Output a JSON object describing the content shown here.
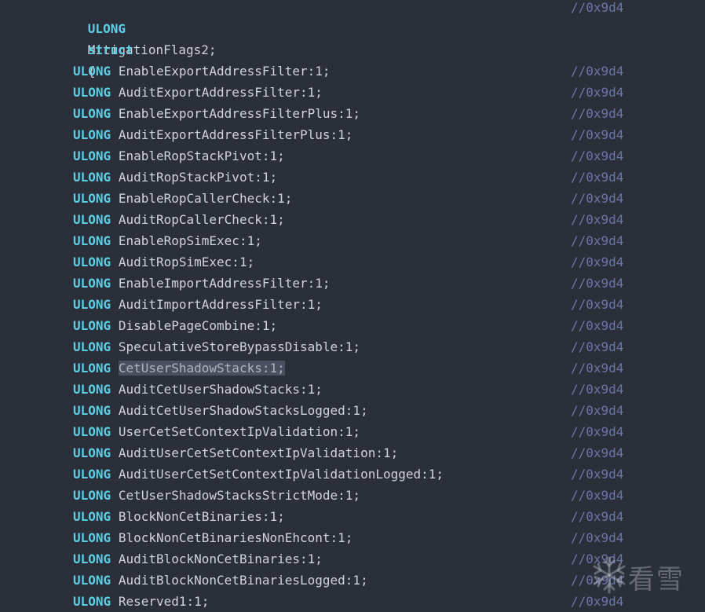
{
  "header": {
    "type_keyword": "ULONG",
    "member": "MitigationFlags2;",
    "comment": "//0x9d4"
  },
  "struct_keyword": "struct",
  "open_brace": "{",
  "fields": [
    {
      "type": "ULONG",
      "decl": "EnableExportAddressFilter:1;",
      "comment": "//0x9d4"
    },
    {
      "type": "ULONG",
      "decl": "AuditExportAddressFilter:1;",
      "comment": "//0x9d4"
    },
    {
      "type": "ULONG",
      "decl": "EnableExportAddressFilterPlus:1;",
      "comment": "//0x9d4"
    },
    {
      "type": "ULONG",
      "decl": "AuditExportAddressFilterPlus:1;",
      "comment": "//0x9d4"
    },
    {
      "type": "ULONG",
      "decl": "EnableRopStackPivot:1;",
      "comment": "//0x9d4"
    },
    {
      "type": "ULONG",
      "decl": "AuditRopStackPivot:1;",
      "comment": "//0x9d4"
    },
    {
      "type": "ULONG",
      "decl": "EnableRopCallerCheck:1;",
      "comment": "//0x9d4"
    },
    {
      "type": "ULONG",
      "decl": "AuditRopCallerCheck:1;",
      "comment": "//0x9d4"
    },
    {
      "type": "ULONG",
      "decl": "EnableRopSimExec:1;",
      "comment": "//0x9d4"
    },
    {
      "type": "ULONG",
      "decl": "AuditRopSimExec:1;",
      "comment": "//0x9d4"
    },
    {
      "type": "ULONG",
      "decl": "EnableImportAddressFilter:1;",
      "comment": "//0x9d4"
    },
    {
      "type": "ULONG",
      "decl": "AuditImportAddressFilter:1;",
      "comment": "//0x9d4"
    },
    {
      "type": "ULONG",
      "decl": "DisablePageCombine:1;",
      "comment": "//0x9d4"
    },
    {
      "type": "ULONG",
      "decl": "SpeculativeStoreBypassDisable:1;",
      "comment": "//0x9d4"
    },
    {
      "type": "ULONG",
      "decl": "CetUserShadowStacks:1;",
      "comment": "//0x9d4",
      "selected": true
    },
    {
      "type": "ULONG",
      "decl": "AuditCetUserShadowStacks:1;",
      "comment": "//0x9d4"
    },
    {
      "type": "ULONG",
      "decl": "AuditCetUserShadowStacksLogged:1;",
      "comment": "//0x9d4"
    },
    {
      "type": "ULONG",
      "decl": "UserCetSetContextIpValidation:1;",
      "comment": "//0x9d4"
    },
    {
      "type": "ULONG",
      "decl": "AuditUserCetSetContextIpValidation:1;",
      "comment": "//0x9d4"
    },
    {
      "type": "ULONG",
      "decl": "AuditUserCetSetContextIpValidationLogged:1;",
      "comment": "//0x9d4"
    },
    {
      "type": "ULONG",
      "decl": "CetUserShadowStacksStrictMode:1;",
      "comment": "//0x9d4"
    },
    {
      "type": "ULONG",
      "decl": "BlockNonCetBinaries:1;",
      "comment": "//0x9d4"
    },
    {
      "type": "ULONG",
      "decl": "BlockNonCetBinariesNonEhcont:1;",
      "comment": "//0x9d4"
    },
    {
      "type": "ULONG",
      "decl": "AuditBlockNonCetBinaries:1;",
      "comment": "//0x9d4"
    },
    {
      "type": "ULONG",
      "decl": "AuditBlockNonCetBinariesLogged:1;",
      "comment": "//0x9d4"
    },
    {
      "type": "ULONG",
      "decl": "Reserved1:1;",
      "comment": "//0x9d4"
    }
  ],
  "watermark": {
    "text": "看雪",
    "icon": "snowflake-icon"
  },
  "colors": {
    "background": "#2b2f3a",
    "keyword": "#5ccfe6",
    "text": "#cfd3dc",
    "comment": "#6d76a8",
    "selection": "#4b5060"
  }
}
